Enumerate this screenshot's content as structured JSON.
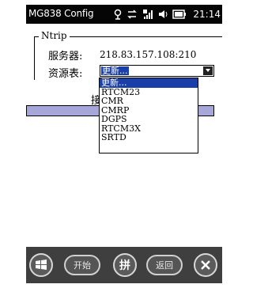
{
  "titlebar": {
    "title": "MG838 Config",
    "time": "21:14",
    "icons": [
      "gps-icon",
      "sync-icon",
      "signal-icon",
      "volume-icon",
      "battery-icon"
    ]
  },
  "group": {
    "legend": "Ntrip",
    "server_label": "服务器:",
    "server_value": "218.83.157.108:210",
    "source_label": "资源表:",
    "source_selected": "更新..."
  },
  "dropdown": {
    "options": [
      "更新...",
      "RTCM23",
      "CMR",
      "CMRP",
      "DGPS",
      "RTCM3X",
      "SRTD"
    ],
    "active_index": 0
  },
  "partial_text": "接",
  "bottombar": {
    "start_label": "开始",
    "ime_label": "拼",
    "back_label": "返回"
  },
  "colors": {
    "selection": "#1a3fa8",
    "bar": "#a6a7d8",
    "titlebar": "#050505",
    "bottombar": "#3f3f3f"
  }
}
